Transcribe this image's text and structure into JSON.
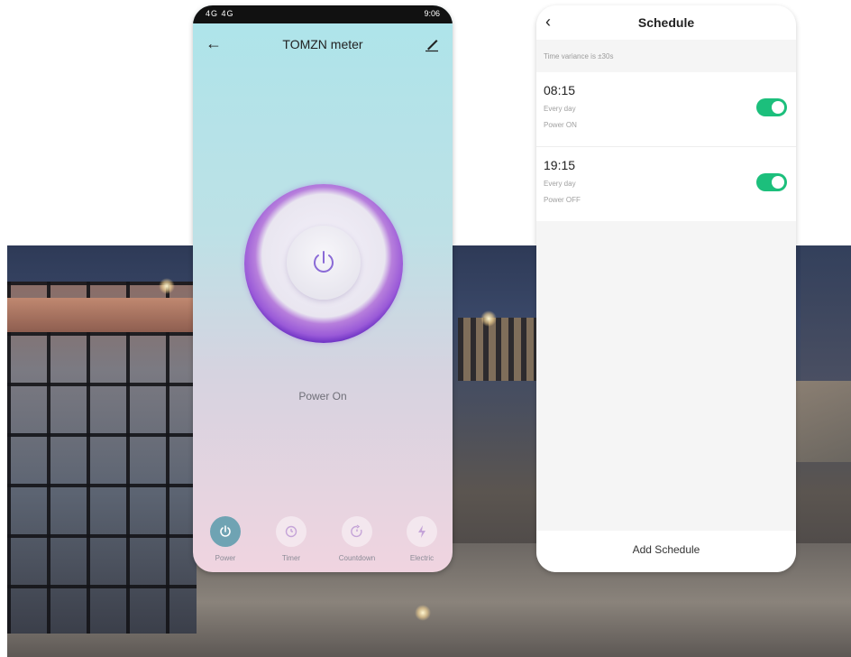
{
  "phone_power": {
    "status_left": "4G 4G",
    "status_right": "9:06",
    "title": "TOMZN meter",
    "power_status": "Power On",
    "nav": [
      {
        "label": "Power",
        "icon": "power-icon",
        "active": true
      },
      {
        "label": "Timer",
        "icon": "timer-icon",
        "active": false
      },
      {
        "label": "Countdown",
        "icon": "countdown-icon",
        "active": false
      },
      {
        "label": "Electric",
        "icon": "electric-icon",
        "active": false
      }
    ]
  },
  "phone_schedule": {
    "title": "Schedule",
    "note": "Time variance is ±30s",
    "items": [
      {
        "time": "08:15",
        "repeat": "Every day",
        "action": "Power ON",
        "enabled": true
      },
      {
        "time": "19:15",
        "repeat": "Every day",
        "action": "Power OFF",
        "enabled": true
      }
    ],
    "add_label": "Add Schedule"
  },
  "colors": {
    "toggle_on": "#1cbf7c",
    "ring_purple": "#9a5ad8",
    "nav_active": "#6fa3b3"
  }
}
